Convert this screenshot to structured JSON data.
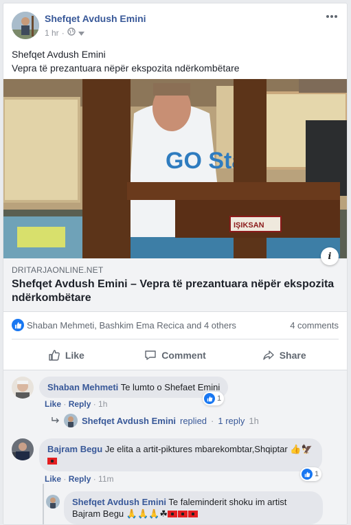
{
  "post": {
    "author": "Shefqet Avdush Emini",
    "time": "1 hr",
    "separator": "·",
    "audience_icon": "globe-icon",
    "body_line1": "Shefqet Avdush Emini",
    "body_line2": "Vepra të prezantuara nëpër ekspozita ndërkombëtare"
  },
  "photo": {
    "easel_brand": "IŞIKSAN",
    "shirt_text": "GO Star"
  },
  "link": {
    "domain": "DRITARJAONLINE.NET",
    "title": "Shefqet Avdush Emini – Vepra të prezantuara nëpër ekspozita ndërkombëtare",
    "info": "i"
  },
  "stats": {
    "likers": "Shaban Mehmeti, Bashkim Ema Recica and 4 others",
    "comments": "4 comments"
  },
  "actions": {
    "like": "Like",
    "comment": "Comment",
    "share": "Share"
  },
  "comments": [
    {
      "name": "Shaban Mehmeti",
      "text": "Te lumto o Shefaet Emini",
      "like": "Like",
      "reply": "Reply",
      "time": "1h",
      "reactions": "1"
    },
    {
      "name": "Bajram Begu",
      "text": "Je elita a artit-piktures mbarekombtar,Shqiptar",
      "like": "Like",
      "reply": "Reply",
      "time": "11m",
      "reactions": "1"
    }
  ],
  "replied_row": {
    "name": "Shefqet Avdush Emini",
    "replied": "replied",
    "sep": "·",
    "count": "1 reply",
    "time": "1h"
  },
  "reply": {
    "name": "Shefqet Avdush Emini",
    "text": "Te faleminderit shoku im artist",
    "text2": "Bajram Begu"
  },
  "colors": {
    "link": "#385898",
    "like_blue": "#1877f2",
    "bg": "#e9ebee",
    "flag_red": "#e41e20"
  }
}
